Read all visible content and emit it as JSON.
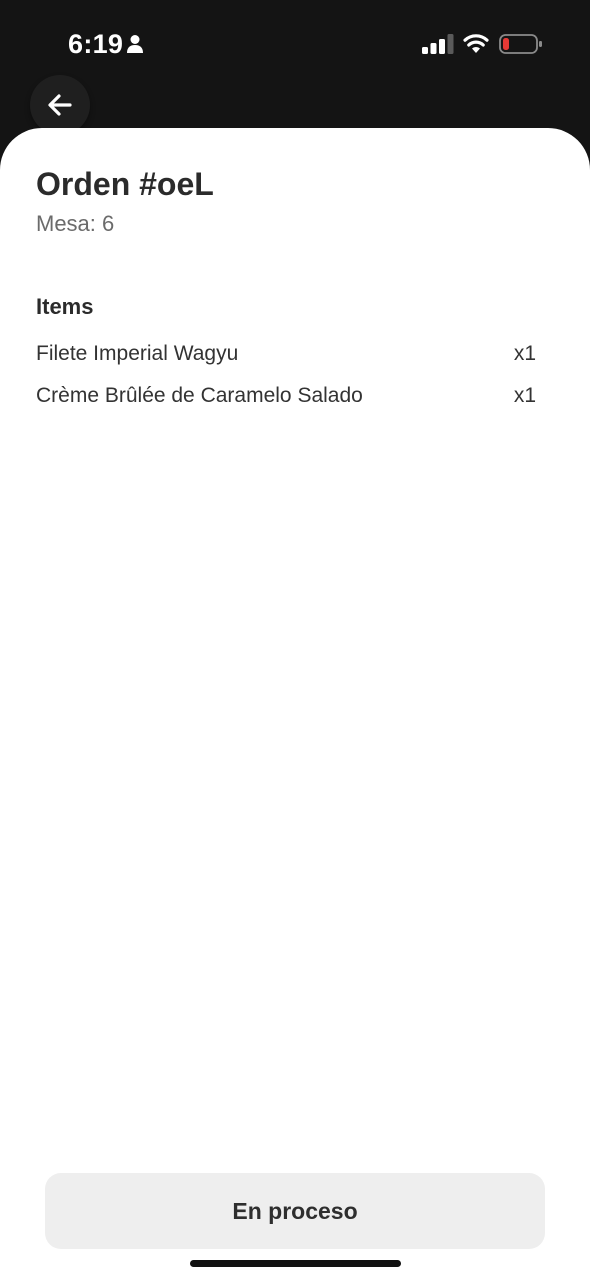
{
  "status_bar": {
    "time": "6:19",
    "icons": [
      "person-icon",
      "cellular-signal-icon",
      "wifi-icon",
      "battery-low-icon"
    ],
    "battery_color": "#e53935"
  },
  "header": {
    "back_icon": "arrow-left-icon"
  },
  "order": {
    "title": "Orden #oeL",
    "table": "Mesa: 6"
  },
  "items_section": {
    "heading": "Items",
    "items": [
      {
        "name": "Filete Imperial Wagyu",
        "qty": "x1"
      },
      {
        "name": "Crème Brûlée de Caramelo Salado",
        "qty": "x1"
      }
    ]
  },
  "footer": {
    "status_button_label": "En proceso"
  },
  "colors": {
    "background_dark": "#141414",
    "sheet": "#ffffff",
    "button_bg": "#eeeeee",
    "text_primary": "#2b2b2b",
    "text_secondary": "#6b6b6b"
  }
}
